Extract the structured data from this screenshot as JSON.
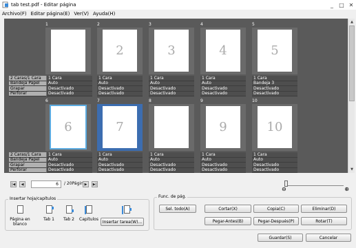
{
  "window": {
    "title": "tab test.pdf - Editar página"
  },
  "menu": [
    "Archivo(F)",
    "Editar página(E)",
    "Ver(V)",
    "Ayuda(H)"
  ],
  "row_labels": [
    "2 Caras/1 Cara",
    "Bandeja Papel",
    "Grapar",
    "Perforar"
  ],
  "pages": [
    {
      "num": "1",
      "thumb": "",
      "props": [
        "1 Cara",
        "Auto",
        "Desactivado",
        "Desactivado"
      ]
    },
    {
      "num": "2",
      "thumb": "2",
      "props": [
        "1 Cara",
        "Auto",
        "Desactivado",
        "Desactivado"
      ]
    },
    {
      "num": "3",
      "thumb": "3",
      "props": [
        "1 Cara",
        "Auto",
        "Desactivado",
        "Desactivado"
      ]
    },
    {
      "num": "4",
      "thumb": "4",
      "props": [
        "1 Cara",
        "Auto",
        "Desactivado",
        "Desactivado"
      ]
    },
    {
      "num": "5",
      "thumb": "5",
      "props": [
        "1 Cara",
        "Bandeja 3",
        "Desactivado",
        "Desactivado"
      ]
    },
    {
      "num": "6",
      "thumb": "6",
      "props": [
        "1 Cara",
        "Auto",
        "Desactivado",
        "Desactivado"
      ]
    },
    {
      "num": "7",
      "thumb": "7",
      "props": [
        "1 Cara",
        "Auto",
        "Desactivado",
        "Desactivado"
      ]
    },
    {
      "num": "8",
      "thumb": "",
      "props": [
        "1 Cara",
        "Auto",
        "Desactivado",
        "Desactivado"
      ]
    },
    {
      "num": "9",
      "thumb": "9",
      "props": [
        "1 Cara",
        "Auto",
        "Desactivado",
        "Desactivado"
      ]
    },
    {
      "num": "10",
      "thumb": "10",
      "props": [
        "1 Cara",
        "Auto",
        "Desactivado",
        "Desactivado"
      ]
    }
  ],
  "nav": {
    "current_page": "6",
    "total": "/ 20Página"
  },
  "insert_group": {
    "title": "Insertar hoja/capítulos",
    "tools": [
      "Página en blanco",
      "Tab 1",
      "Tab 2",
      "Capítulos"
    ],
    "insert_tab_button": "Insertar tarea(W)..."
  },
  "func_group": {
    "title": "Func. de pág.",
    "buttons_row1": [
      "Sel. todo(A)",
      "Cortar(X)",
      "Copia(C)",
      "Eliminar(D)"
    ],
    "buttons_row2": [
      "Pegar-Antes(B)",
      "Pegar-Después(P)",
      "Rotar(T)"
    ]
  },
  "footer": {
    "save": "Guardar(S)",
    "cancel": "Cancelar"
  },
  "colors": {
    "viewer_bg": "#5a5a5a",
    "selected_outline": "#5aaae0",
    "highlight": "#3c6db0"
  }
}
